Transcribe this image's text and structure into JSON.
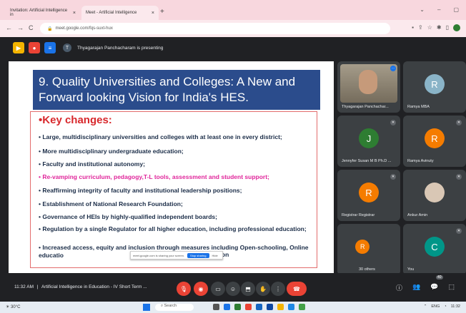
{
  "browser": {
    "tabs": [
      {
        "label": "Invitation: Artificial Intelligence in",
        "close": "×"
      },
      {
        "label": "Meet - Artificial Intelligence",
        "close": "×"
      }
    ],
    "new_tab": "+",
    "url": "meet.google.com/fqs-suxt-hux",
    "nav": {
      "back": "←",
      "forward": "→",
      "reload": "C"
    }
  },
  "meet_top": {
    "presenting_text": "Thyagarajan Panchacharam is presenting"
  },
  "slide": {
    "title": "9. Quality Universities and Colleges: A New and Forward looking Vision for India's HES.",
    "heading": "Key changes:",
    "bullets": [
      "Large, multidisciplinary universities and colleges with at least one in every district;",
      "More multidisciplinary undergraduate education;",
      "Faculty and institutional autonomy;",
      "Re-vamping curriculum, pedagogy,T-L tools, assessment and student support;",
      "Reaffirming integrity of faculty and institutional leadership positions;",
      "Establishment of National Research Foundation;",
      "Governance of HEIs by highly-qualified independent boards;",
      "Regulation by a single Regulator for all higher education, including professional education;",
      "Increased access, equity and inclusion through measures including Open-schooling, Online educatio"
    ],
    "bullet_tail": "ation",
    "share_overlay": {
      "text": "meet.google.com is sharing your screen.",
      "stop": "Stop sharing",
      "hide": "Hide"
    }
  },
  "participants": [
    {
      "name": "Thyagarajan Panchachar...",
      "initial": "",
      "color": ""
    },
    {
      "name": "Ramya MBA",
      "initial": "R",
      "color": "#8ab4c8"
    },
    {
      "name": "Jennyfer Susan M B Ph.D ...",
      "initial": "J",
      "color": "#2e7d32"
    },
    {
      "name": "Ramya Avinuty",
      "initial": "R",
      "color": "#f57c00"
    },
    {
      "name": "Registrar Registrar",
      "initial": "R",
      "color": "#f57c00"
    },
    {
      "name": "Ankur Amin",
      "initial": "",
      "color": ""
    },
    {
      "name": "30 others",
      "initial": "R",
      "color": "#f57c00"
    },
    {
      "name": "You",
      "initial": "C",
      "color": "#009688"
    }
  ],
  "bottom": {
    "time": "11:32 AM",
    "meeting": "Artificial Intelligence in Education - IV Short Term ...",
    "participant_count": "40"
  },
  "taskbar": {
    "temp": "30°C",
    "search": "Search",
    "tray_lang": "ENG",
    "clock": "11:32"
  }
}
